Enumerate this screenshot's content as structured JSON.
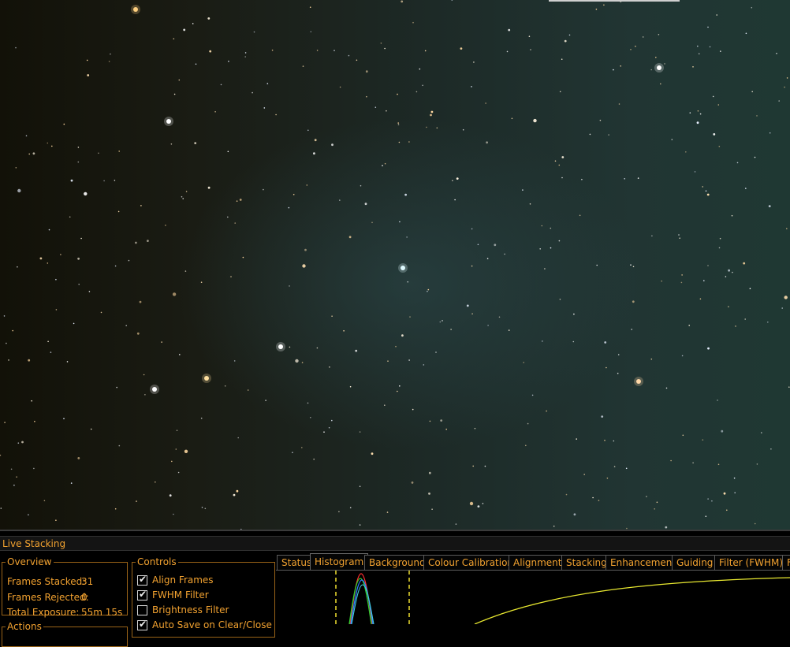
{
  "panel": {
    "title": "Live Stacking"
  },
  "overview": {
    "legend": "Overview",
    "stats": [
      {
        "label": "Frames Stacked:",
        "value": "31"
      },
      {
        "label": "Frames Rejected:",
        "value": "0"
      },
      {
        "label": "Total Exposure:",
        "value": "55m 15s"
      }
    ]
  },
  "actions": {
    "legend": "Actions"
  },
  "controls": {
    "legend": "Controls",
    "items": [
      {
        "label": "Align Frames",
        "checked": true
      },
      {
        "label": "FWHM Filter",
        "checked": true
      },
      {
        "label": "Brightness Filter",
        "checked": false
      },
      {
        "label": "Auto Save on Clear/Close",
        "checked": true
      }
    ]
  },
  "tabs": [
    "Status",
    "Histogram",
    "Background",
    "Colour Calibration",
    "Alignment",
    "Stacking",
    "Enhancement",
    "Guiding",
    "Filter (FWHM)",
    "F"
  ],
  "active_tab": "Histogram",
  "colors": {
    "accent": "#f2a230",
    "curve_yellow": "#e8e830",
    "hist_red": "#ff3030",
    "hist_green": "#30d030",
    "hist_blue": "#3080ff",
    "hist_cyan": "#40d0e0"
  }
}
